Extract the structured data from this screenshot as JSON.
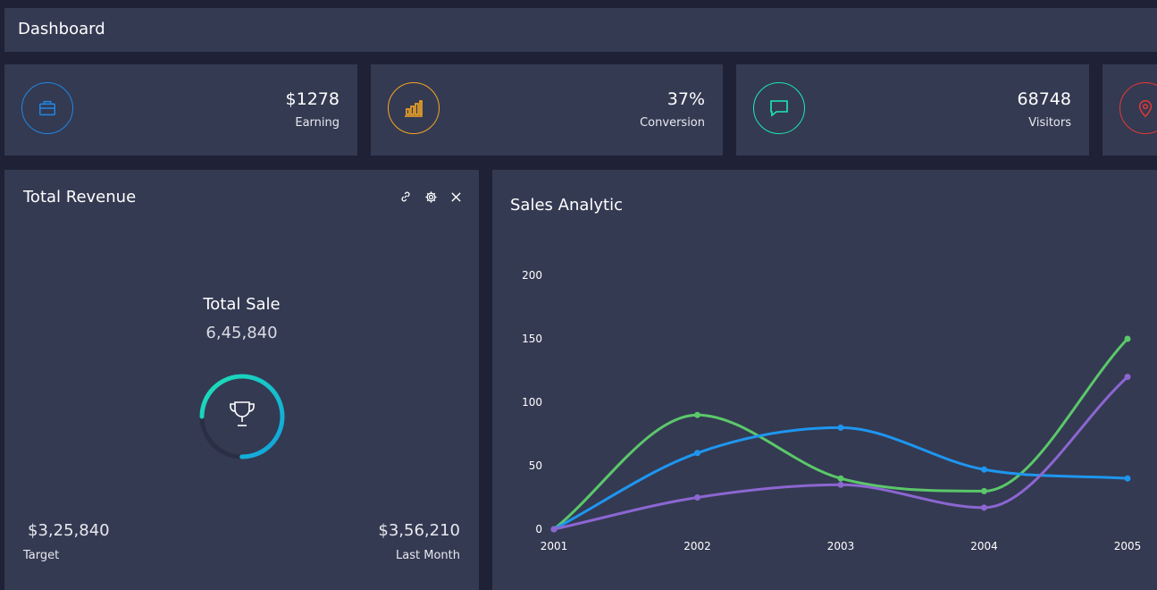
{
  "header": {
    "title": "Dashboard"
  },
  "stats": [
    {
      "value": "$1278",
      "label": "Earning",
      "icon": "briefcase-icon",
      "color": "#1e88e5"
    },
    {
      "value": "37%",
      "label": "Conversion",
      "icon": "bar-chart-icon",
      "color": "#f5a623"
    },
    {
      "value": "68748",
      "label": "Visitors",
      "icon": "chat-icon",
      "color": "#1de9b6"
    },
    {
      "value": "",
      "label": "",
      "icon": "map-pin-icon",
      "color": "#e53935"
    }
  ],
  "revenue": {
    "title": "Total Revenue",
    "sale_title": "Total Sale",
    "sale_value": "6,45,840",
    "progress": 0.75,
    "target_value": "$3,25,840",
    "target_label": "Target",
    "last_month_value": "$3,56,210",
    "last_month_label": "Last Month",
    "tool_icons": [
      "link-icon",
      "gear-icon",
      "close-icon"
    ]
  },
  "sales": {
    "title": "Sales Analytic"
  },
  "chart_data": {
    "type": "line",
    "categories": [
      "2001",
      "2002",
      "2003",
      "2004",
      "2005"
    ],
    "ylim": [
      0,
      200
    ],
    "yticks": [
      0,
      50,
      100,
      150,
      200
    ],
    "series": [
      {
        "values": [
          0,
          90,
          40,
          30,
          150
        ],
        "color": "#5bc86a"
      },
      {
        "values": [
          0,
          60,
          80,
          47,
          40
        ],
        "color": "#1e96f0"
      },
      {
        "values": [
          0,
          25,
          35,
          17,
          120
        ],
        "color": "#8c66d1"
      }
    ]
  }
}
